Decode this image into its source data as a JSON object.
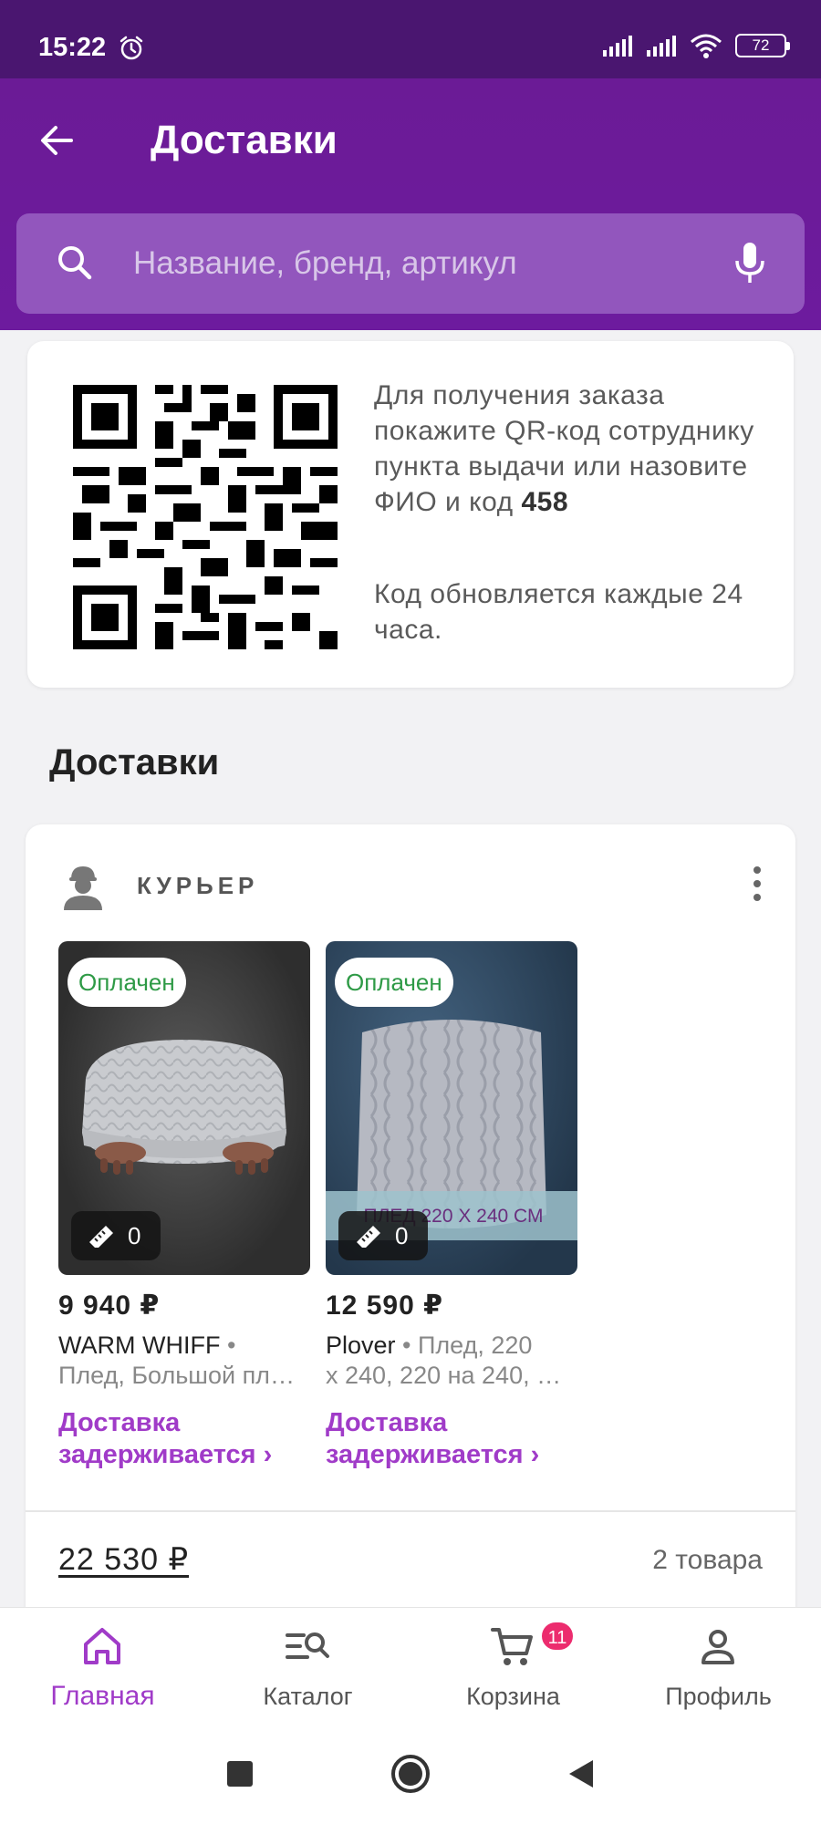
{
  "status_bar": {
    "time": "15:22",
    "battery": "72"
  },
  "header": {
    "title": "Доставки",
    "search_placeholder": "Название, бренд, артикул"
  },
  "qr_card": {
    "instruction_text": "Для получения заказа покажите QR-код сотруднику пункта выдачи или назовите ФИО и код",
    "code": "458",
    "note": "Код обновляется каждые 24 часа."
  },
  "section_title": "Доставки",
  "delivery": {
    "method": "КУРЬЕР",
    "products": [
      {
        "badge": "Оплачен",
        "size_count": "0",
        "price": "9 940 ₽",
        "brand": "WARM WHIFF",
        "separator": " • ",
        "description_line1": "",
        "description_line2": "Плед, Большой пл…",
        "status_line1": "Доставка",
        "status_line2": "задерживается ›"
      },
      {
        "badge": "Оплачен",
        "size_count": "0",
        "price": "12 590 ₽",
        "brand": "Plover",
        "separator": " • ",
        "description_line1": "Плед, 220",
        "description_line2": "x 240, 220 на 240, …",
        "status_line1": "Доставка",
        "status_line2": "задерживается ›",
        "image_text": "ПЛЕД 220 X 240 СМ"
      }
    ],
    "total": "22 530 ₽",
    "items_count": "2 товара"
  },
  "bottom_nav": [
    {
      "label": "Главная",
      "icon": "home-icon",
      "active": true
    },
    {
      "label": "Каталог",
      "icon": "catalog-search-icon"
    },
    {
      "label": "Корзина",
      "icon": "cart-icon",
      "badge": "11"
    },
    {
      "label": "Профиль",
      "icon": "profile-icon"
    }
  ],
  "colors": {
    "status_bar": "#4a1670",
    "header": "#6d1b9e",
    "accent": "#a03bc8",
    "paid_green": "#2e9a46",
    "badge_pink": "#ec2c6e"
  }
}
